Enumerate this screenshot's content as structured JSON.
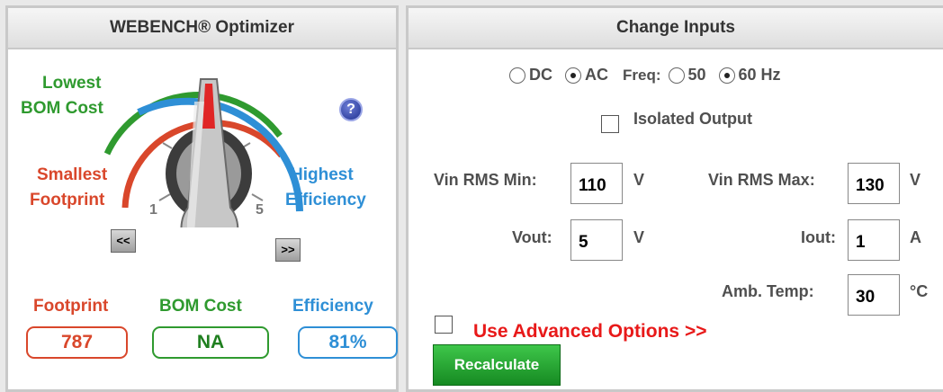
{
  "optimizer": {
    "title": "WEBENCH® Optimizer",
    "dial": {
      "top_label_line1": "Lowest",
      "top_label_line2": "BOM Cost",
      "left_label_line1": "Smallest",
      "left_label_line2": "Footprint",
      "right_label_line1": "Highest",
      "right_label_line2": "Efficiency",
      "min_tick": "1",
      "max_tick": "5",
      "prev_button": "<<",
      "next_button": ">>",
      "help_icon": "question-icon"
    },
    "metrics": {
      "footprint_label": "Footprint",
      "footprint_value": "787",
      "bom_label": "BOM Cost",
      "bom_value": "NA",
      "efficiency_label": "Efficiency",
      "efficiency_value": "81%"
    },
    "colors": {
      "footprint": "#d9472b",
      "bom": "#2f9a2f",
      "efficiency": "#2e8fd6"
    }
  },
  "inputs": {
    "title": "Change Inputs",
    "mode": {
      "dc_label": "DC",
      "ac_label": "AC",
      "selected": "AC"
    },
    "freq": {
      "label": "Freq:",
      "opt50": "50",
      "opt60": "60 Hz",
      "selected": "60 Hz"
    },
    "isolated_output": {
      "label": "Isolated Output",
      "checked": false
    },
    "vin_min": {
      "label": "Vin RMS Min:",
      "value": "110",
      "unit": "V"
    },
    "vin_max": {
      "label": "Vin RMS Max:",
      "value": "130",
      "unit": "V"
    },
    "vout": {
      "label": "Vout:",
      "value": "5",
      "unit": "V"
    },
    "iout": {
      "label": "Iout:",
      "value": "1",
      "unit": "A"
    },
    "amb_temp": {
      "label": "Amb. Temp:",
      "value": "30",
      "unit": "°C"
    },
    "advanced": {
      "label": "Use Advanced Options >>",
      "checked": false
    },
    "recalculate_label": "Recalculate"
  }
}
